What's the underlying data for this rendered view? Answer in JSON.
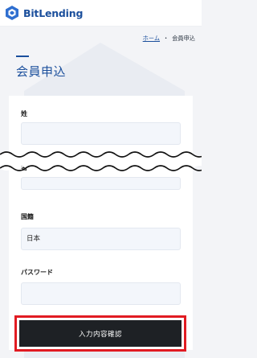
{
  "brand": {
    "name": "BitLending",
    "color": "#1b4f9c"
  },
  "breadcrumb": {
    "home": "ホーム",
    "separator": "・",
    "current": "会員申込"
  },
  "page": {
    "title": "会員申込"
  },
  "form": {
    "last_name": {
      "label": "姓",
      "value": ""
    },
    "first_name": {
      "label": "名"
    },
    "country": {
      "label": "国籍",
      "value": "日本"
    },
    "password": {
      "label": "パスワード",
      "value": ""
    }
  },
  "submit": {
    "label": "入力内容確認",
    "highlight_color": "#e11b22"
  }
}
